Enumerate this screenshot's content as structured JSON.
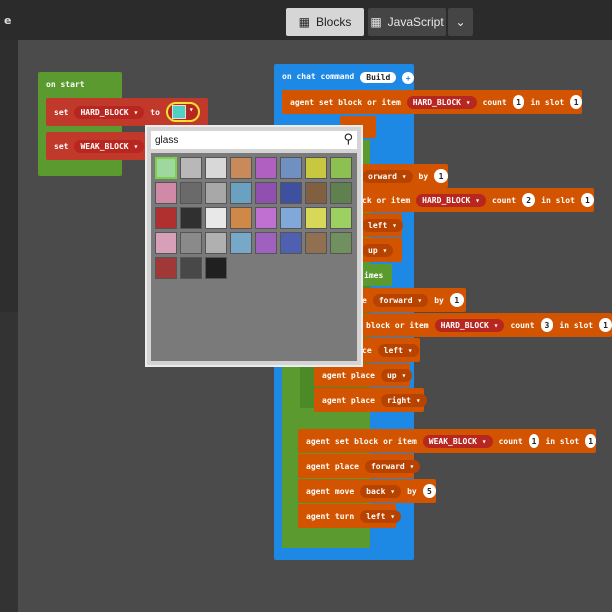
{
  "window": {
    "title_fragment": "e"
  },
  "tabs": {
    "blocks": "Blocks",
    "javascript": "JavaScript",
    "blocks_icon": "block-icon",
    "menu_icon": "chevron-down-icon"
  },
  "on_start": {
    "header": "on start",
    "set1": {
      "keyword": "set",
      "variable": "HARD_BLOCK",
      "to": "to"
    },
    "set2": {
      "keyword": "set",
      "variable": "WEAK_BLOCK",
      "to": "t"
    }
  },
  "picker": {
    "search_value": "glass",
    "colors": [
      [
        "#9fd89f",
        "#b8b8b8",
        "#d8d8d8",
        "#c88a5a",
        "#b060c0",
        "#6f90c0",
        "#c8c840",
        "#8cc050"
      ],
      [
        "#d08aa8",
        "#6a6a6a",
        "#a8a8a8",
        "#6aa0c0",
        "#9050b0",
        "#4050a0",
        "#806040",
        "#608050"
      ],
      [
        "#b03030",
        "#303030",
        "#e8e8e8",
        "#d08848",
        "#c070d0",
        "#80a8d8",
        "#d8d858",
        "#9cd060"
      ],
      [
        "#d8a0b8",
        "#8a8a8a",
        "#b0b0b0",
        "#78a8c8",
        "#a060c0",
        "#5060b0",
        "#907050",
        "#709060"
      ],
      [
        "#a03838",
        "#484848",
        "#202020"
      ]
    ]
  },
  "chat": {
    "header": "on chat command",
    "command": "Build",
    "add_icon": "plus-icon",
    "set_block": {
      "text": "agent set block or item",
      "item": "HARD_BLOCK",
      "count": "count",
      "count_value": "1",
      "in_slot": "in slot",
      "slot_value": "1"
    },
    "frag_orward": "orward",
    "frag_by1": "by",
    "frag_by1_value": "1",
    "frag_ck_or_item": "ck or item",
    "frag_item2": "HARD_BLOCK",
    "frag_count2": "count",
    "frag_count2_value": "2",
    "frag_in_slot2": "in slot",
    "frag_slot2_value": "1",
    "frag_left": "left",
    "frag_up": "up",
    "frag_imes": "imes",
    "frag_e": "e",
    "frag_forward2": "forward",
    "frag_by2": "by",
    "frag_by2_value": "1",
    "frag_block_or_item": "block or item",
    "frag_item3": "HARD_BLOCK",
    "frag_count3": "count",
    "frag_count3_value": "3",
    "frag_in_slot3": "in slot",
    "frag_slot3_value": "1",
    "frag_ce": "ce",
    "frag_left2": "left",
    "place_up": {
      "text": "agent place",
      "dir": "up"
    },
    "place_right": {
      "text": "agent place",
      "dir": "right"
    },
    "set_weak": {
      "text": "agent set block or item",
      "item": "WEAK_BLOCK",
      "count": "count",
      "count_value": "1",
      "in_slot": "in slot",
      "slot_value": "1"
    },
    "place_forward": {
      "text": "agent place",
      "dir": "forward"
    },
    "move_back": {
      "text": "agent move",
      "dir": "back",
      "by": "by",
      "by_value": "5"
    },
    "turn_left": {
      "text": "agent turn",
      "dir": "left"
    }
  }
}
